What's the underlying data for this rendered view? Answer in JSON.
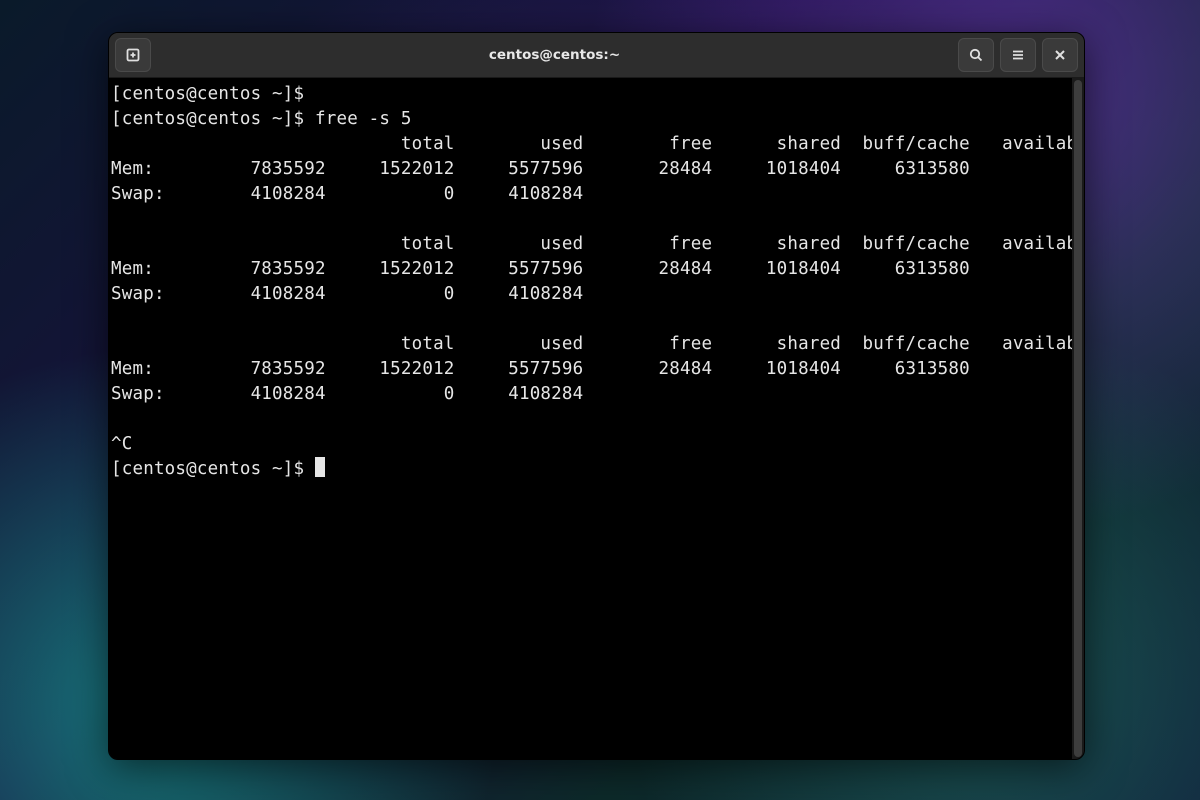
{
  "window": {
    "title": "centos@centos:~"
  },
  "prompt": "[centos@centos ~]$ ",
  "command": "free -s 5",
  "interrupt": "^C",
  "header_cols": [
    "total",
    "used",
    "free",
    "shared",
    "buff/cache",
    "available"
  ],
  "row_labels": {
    "mem": "Mem:",
    "swap": "Swap:"
  },
  "samples": [
    {
      "mem": [
        7835592,
        1522012,
        5577596,
        28484,
        1018404,
        6313580
      ],
      "swap": [
        4108284,
        0,
        4108284
      ]
    },
    {
      "mem": [
        7835592,
        1522012,
        5577596,
        28484,
        1018404,
        6313580
      ],
      "swap": [
        4108284,
        0,
        4108284
      ]
    },
    {
      "mem": [
        7835592,
        1522012,
        5577596,
        28484,
        1018404,
        6313580
      ],
      "swap": [
        4108284,
        0,
        4108284
      ]
    }
  ],
  "col_widths": {
    "label": 8,
    "data": 12
  },
  "header_indent": 20
}
